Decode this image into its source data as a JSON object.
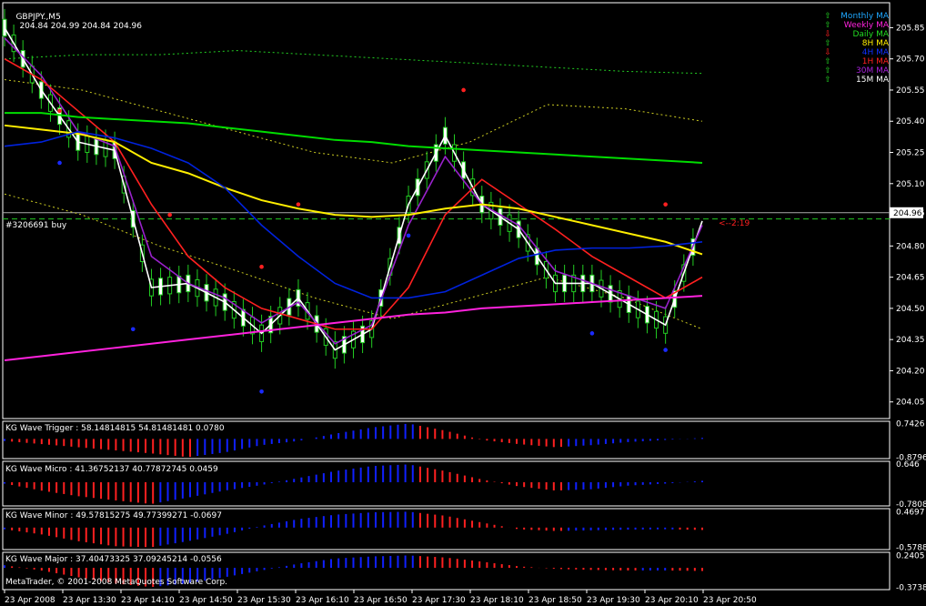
{
  "colors": {
    "bg": "#000000",
    "grid": "#ffffff",
    "candle": "#22cc22",
    "white_line": "#ffffff",
    "purple_line": "#9922cc",
    "red_line": "#ff2020",
    "green_line": "#00dd00",
    "yellow_line": "#ffee00",
    "blue_line": "#0022dd",
    "magenta_line": "#ff22dd",
    "hist_red": "#ff2020",
    "hist_blue": "#1020ff",
    "marker_red": "#ff2020",
    "marker_blue": "#1a2aff"
  },
  "header": {
    "symbol": "GBPJPY.,M5",
    "ohlc": "204.84 204.99 204.84 204.96"
  },
  "trade": {
    "label": "#3206691 buy",
    "arrow_label": "<--2:19"
  },
  "current_price": "204.96",
  "copyright": "MetaTrader, © 2001-2008 MetaQuotes Software Corp.",
  "legend": [
    {
      "arrow": "⇧",
      "label": "Monthly MA",
      "color": "#1ea7ff",
      "arrow_color": "#22cc22"
    },
    {
      "arrow": "⇧",
      "label": "Weekly MA",
      "color": "#ff22dd",
      "arrow_color": "#22cc22"
    },
    {
      "arrow": "⇩",
      "label": "Daily MA",
      "color": "#22dd22",
      "arrow_color": "#ff2020"
    },
    {
      "arrow": "⇧",
      "label": "8H MA",
      "color": "#ffee00",
      "arrow_color": "#22cc22"
    },
    {
      "arrow": "⇩",
      "label": "4H MA",
      "color": "#1030ff",
      "arrow_color": "#ff2020"
    },
    {
      "arrow": "⇧",
      "label": "1H MA",
      "color": "#ff2020",
      "arrow_color": "#22cc22"
    },
    {
      "arrow": "⇧",
      "label": "30M MA",
      "color": "#aa22dd",
      "arrow_color": "#22cc22"
    },
    {
      "arrow": "⇧",
      "label": "15M MA",
      "color": "#ffffff",
      "arrow_color": "#22cc22"
    }
  ],
  "chart_data": [
    {
      "type": "line",
      "title": "GBPJPY.,M5 204.84 204.99 204.84 204.96",
      "ylim": [
        203.97,
        205.97
      ],
      "y_ticks": [
        205.85,
        205.7,
        205.55,
        205.4,
        205.25,
        205.1,
        204.96,
        204.8,
        204.65,
        204.5,
        204.35,
        204.2,
        204.05
      ],
      "y_tick_labels": [
        "205.85",
        "205.70",
        "205.55",
        "205.40",
        "205.25",
        "205.10",
        "204.96",
        "204.80",
        "204.65",
        "204.50",
        "204.35",
        "204.20",
        "204.05"
      ],
      "x_labels": [
        "23 Apr 2008",
        "23 Apr 13:30",
        "23 Apr 14:10",
        "23 Apr 14:50",
        "23 Apr 15:30",
        "23 Apr 16:10",
        "23 Apr 16:50",
        "23 Apr 17:30",
        "23 Apr 18:10",
        "23 Apr 18:50",
        "23 Apr 19:30",
        "23 Apr 20:10",
        "23 Apr 20:50"
      ],
      "x": [
        0,
        8,
        16,
        24,
        32,
        40,
        48,
        56,
        64,
        72,
        80,
        88,
        96
      ],
      "series": [
        {
          "color": "#ffffff",
          "values": [
            205.85,
            205.55,
            205.3,
            205.26,
            204.6,
            204.62,
            204.53,
            204.38,
            204.55,
            204.3,
            204.4,
            205.0,
            205.33,
            205.0,
            204.88,
            204.62,
            204.62,
            204.52,
            204.42,
            204.92
          ]
        },
        {
          "color": "#9922cc",
          "values": [
            205.8,
            205.62,
            205.35,
            205.28,
            204.75,
            204.62,
            204.55,
            204.43,
            204.53,
            204.33,
            204.42,
            204.9,
            205.23,
            205.0,
            204.9,
            204.68,
            204.62,
            204.56,
            204.5,
            204.9
          ]
        },
        {
          "color": "#ff2020",
          "values": [
            205.7,
            205.6,
            205.45,
            205.3,
            205.0,
            204.75,
            204.6,
            204.5,
            204.45,
            204.4,
            204.4,
            204.6,
            204.95,
            205.12,
            205.0,
            204.88,
            204.75,
            204.65,
            204.55,
            204.65
          ]
        },
        {
          "color": "#ffee00",
          "values": [
            205.38,
            205.36,
            205.34,
            205.3,
            205.2,
            205.15,
            205.08,
            205.02,
            204.98,
            204.95,
            204.94,
            204.95,
            204.98,
            205.0,
            204.98,
            204.94,
            204.9,
            204.86,
            204.82,
            204.76
          ]
        },
        {
          "color": "#0022dd",
          "values": [
            205.28,
            205.3,
            205.35,
            205.32,
            205.27,
            205.2,
            205.08,
            204.9,
            204.75,
            204.62,
            204.55,
            204.55,
            204.58,
            204.66,
            204.74,
            204.78,
            204.79,
            204.79,
            204.8,
            204.82
          ]
        },
        {
          "color": "#00dd00",
          "values": [
            205.44,
            205.44,
            205.42,
            205.41,
            205.4,
            205.39,
            205.37,
            205.35,
            205.33,
            205.31,
            205.3,
            205.28,
            205.27,
            205.26,
            205.25,
            205.24,
            205.23,
            205.22,
            205.21,
            205.2
          ]
        },
        {
          "color": "#ff22dd",
          "values": [
            204.25,
            204.27,
            204.29,
            204.31,
            204.33,
            204.35,
            204.37,
            204.39,
            204.41,
            204.43,
            204.45,
            204.47,
            204.48,
            204.5,
            204.51,
            204.52,
            204.53,
            204.54,
            204.55,
            204.56
          ]
        }
      ],
      "x_steps": 19
    },
    {
      "type": "bar",
      "title": "KG Wave Trigger : 58.14814815 54.81481481 0.0780",
      "y_ticks": [
        0.7426,
        -0.8796
      ],
      "y_tick_labels": [
        "0.7426",
        "-0.8796"
      ],
      "ylim": [
        -0.95,
        0.85
      ],
      "values": [
        -0.1,
        -0.25,
        -0.4,
        -0.55,
        -0.7,
        -0.88,
        -0.65,
        -0.3,
        -0.1,
        0.25,
        0.55,
        0.74,
        0.4,
        -0.05,
        -0.25,
        -0.4,
        -0.3,
        -0.15,
        -0.05,
        0.05
      ]
    },
    {
      "type": "bar",
      "title": "KG Wave Micro : 41.36752137 40.77872745 0.0459",
      "y_ticks": [
        0.646,
        -0.7808
      ],
      "y_tick_labels": [
        "0.646",
        "-0.7808"
      ],
      "ylim": [
        -0.85,
        0.75
      ],
      "values": [
        -0.05,
        -0.3,
        -0.5,
        -0.65,
        -0.78,
        -0.55,
        -0.3,
        -0.1,
        0.15,
        0.4,
        0.58,
        0.64,
        0.4,
        0.1,
        -0.15,
        -0.3,
        -0.25,
        -0.12,
        -0.05,
        0.05
      ]
    },
    {
      "type": "bar",
      "title": "KG Wave Minor : 49.57815275 49.77399271 -0.0697",
      "y_ticks": [
        0.4697,
        -0.5788
      ],
      "y_tick_labels": [
        "0.4697",
        "-0.5788"
      ],
      "ylim": [
        -0.65,
        0.56
      ],
      "values": [
        -0.05,
        -0.2,
        -0.4,
        -0.55,
        -0.58,
        -0.4,
        -0.2,
        0.05,
        0.25,
        0.38,
        0.45,
        0.47,
        0.35,
        0.15,
        -0.05,
        -0.1,
        -0.08,
        -0.06,
        -0.05,
        -0.07
      ]
    },
    {
      "type": "bar",
      "title": "KG Wave Major : 37.40473325 37.09245214 -0.0556",
      "y_ticks": [
        0.2405,
        -0.3738
      ],
      "y_tick_labels": [
        "0.2405",
        "-0.3738"
      ],
      "ylim": [
        -0.42,
        0.3
      ],
      "values": [
        0.05,
        -0.05,
        -0.18,
        -0.3,
        -0.37,
        -0.3,
        -0.18,
        -0.05,
        0.08,
        0.18,
        0.22,
        0.24,
        0.2,
        0.12,
        0.03,
        -0.02,
        -0.04,
        -0.05,
        -0.05,
        -0.06
      ]
    }
  ]
}
